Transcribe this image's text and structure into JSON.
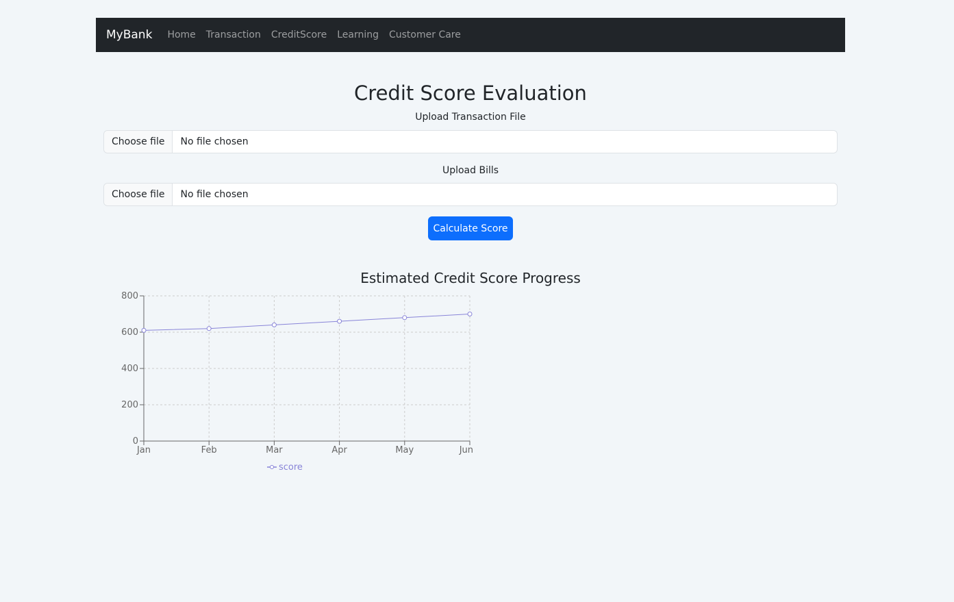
{
  "navbar": {
    "brand": "MyBank",
    "links": [
      "Home",
      "Transaction",
      "CreditScore",
      "Learning",
      "Customer Care"
    ]
  },
  "page": {
    "title": "Credit Score Evaluation"
  },
  "uploads": [
    {
      "label": "Upload Transaction File",
      "button": "Choose file",
      "status": "No file chosen"
    },
    {
      "label": "Upload Bills",
      "button": "Choose file",
      "status": "No file chosen"
    }
  ],
  "actions": {
    "calculate_label": "Calculate Score"
  },
  "colors": {
    "navbar_bg": "#212529",
    "primary": "#0d6efd",
    "series": "#8884d8",
    "background": "#f2f6f9"
  },
  "chart_data": {
    "type": "line",
    "title": "Estimated Credit Score Progress",
    "categories": [
      "Jan",
      "Feb",
      "Mar",
      "Apr",
      "May",
      "Jun"
    ],
    "series": [
      {
        "name": "score",
        "values": [
          610,
          620,
          640,
          660,
          680,
          700
        ]
      }
    ],
    "ylim": [
      0,
      800
    ],
    "yticks": [
      0,
      200,
      400,
      600,
      800
    ],
    "grid": true,
    "legend": "bottom"
  }
}
